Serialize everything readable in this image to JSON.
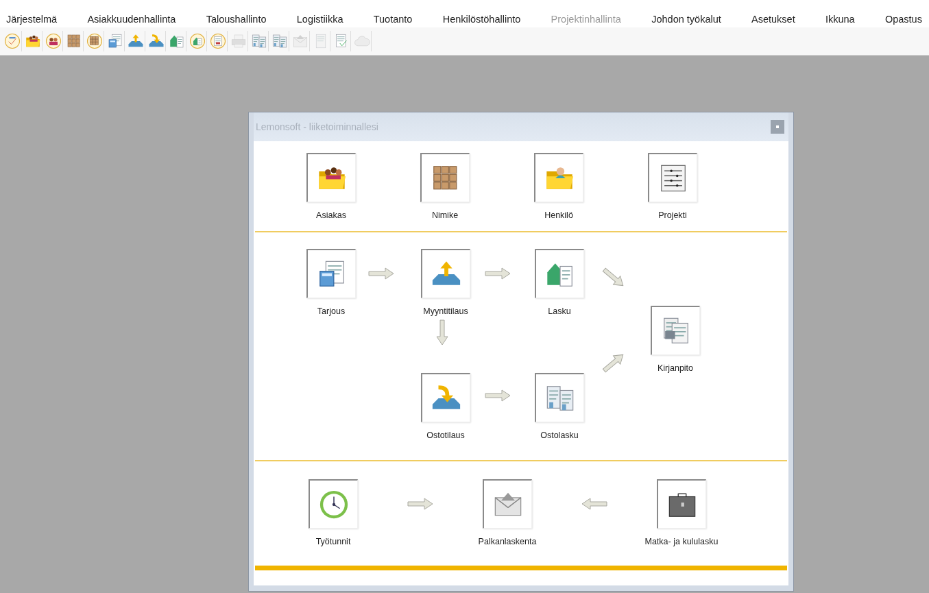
{
  "menu": [
    {
      "label": "Järjestelmä",
      "disabled": false
    },
    {
      "label": "Asiakkuudenhallinta",
      "disabled": false
    },
    {
      "label": "Taloushallinto",
      "disabled": false
    },
    {
      "label": "Logistiikka",
      "disabled": false
    },
    {
      "label": "Tuotanto",
      "disabled": false
    },
    {
      "label": "Henkilöstöhallinto",
      "disabled": false
    },
    {
      "label": "Projektinhallinta",
      "disabled": true
    },
    {
      "label": "Johdon työkalut",
      "disabled": false
    },
    {
      "label": "Asetukset",
      "disabled": false
    },
    {
      "label": "Ikkuna",
      "disabled": false
    },
    {
      "label": "Opastus",
      "disabled": false
    }
  ],
  "toolbar": [
    {
      "kind": "check-circle",
      "disabled": false
    },
    {
      "kind": "folder-people",
      "disabled": false
    },
    {
      "kind": "people-circle",
      "disabled": false
    },
    {
      "kind": "boxes",
      "disabled": false
    },
    {
      "kind": "boxes-circle",
      "disabled": false
    },
    {
      "kind": "calculator-doc",
      "disabled": false
    },
    {
      "kind": "tray-up",
      "disabled": false
    },
    {
      "kind": "tray-down",
      "disabled": false
    },
    {
      "kind": "house-doc",
      "disabled": false
    },
    {
      "kind": "house-circle",
      "disabled": false
    },
    {
      "kind": "doc-circle",
      "disabled": false
    },
    {
      "kind": "printer",
      "disabled": true
    },
    {
      "kind": "docs",
      "disabled": false
    },
    {
      "kind": "docs",
      "disabled": false
    },
    {
      "kind": "envelope",
      "disabled": true
    },
    {
      "kind": "doc",
      "disabled": true
    },
    {
      "kind": "doc-check",
      "disabled": false
    },
    {
      "kind": "cloud",
      "disabled": true
    }
  ],
  "dialog": {
    "title": "Lemonsoft - liiketoiminnallesi",
    "registers": [
      {
        "label": "Asiakas",
        "kind": "folder-people"
      },
      {
        "label": "Nimike",
        "kind": "boxes"
      },
      {
        "label": "Henkilö",
        "kind": "folder-person"
      },
      {
        "label": "Projekti",
        "kind": "list-doc"
      }
    ],
    "flow": [
      {
        "label": "Tarjous",
        "kind": "calculator-doc"
      },
      {
        "label": "Myyntitilaus",
        "kind": "tray-up"
      },
      {
        "label": "Lasku",
        "kind": "house-doc"
      },
      {
        "label": "Kirjanpito",
        "kind": "docs-grey"
      },
      {
        "label": "Ostotilaus",
        "kind": "tray-down"
      },
      {
        "label": "Ostolasku",
        "kind": "docs"
      }
    ],
    "payroll": [
      {
        "label": "Työtunnit",
        "kind": "clock"
      },
      {
        "label": "Palkanlaskenta",
        "kind": "envelope"
      },
      {
        "label": "Matka- ja kululasku",
        "kind": "briefcase"
      }
    ]
  }
}
